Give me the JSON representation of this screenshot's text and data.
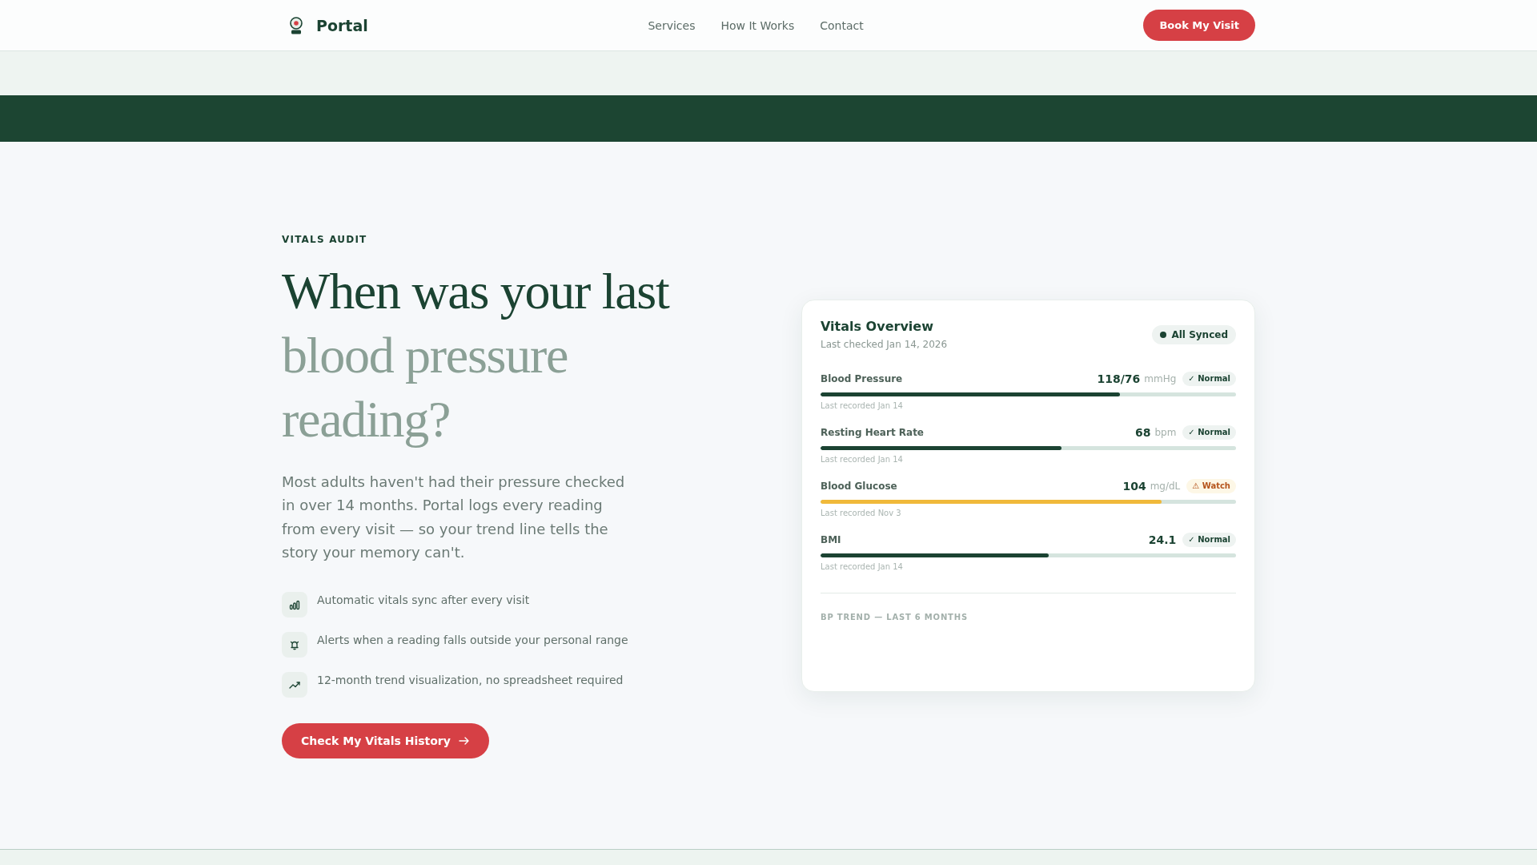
{
  "header": {
    "logo_text": "Portal",
    "nav": [
      {
        "label": "Services"
      },
      {
        "label": "How It Works"
      },
      {
        "label": "Contact"
      }
    ],
    "cta": "Book My Visit"
  },
  "hero": {
    "eyebrow": "VITALS AUDIT",
    "headline": [
      {
        "text": "When was your last",
        "kind": "strong"
      },
      {
        "text": "blood pressure reading?",
        "kind": "muted"
      }
    ],
    "body": "Most adults haven't had their pressure checked in over 14 months. Portal logs every reading from every visit — so your trend line tells the story your memory can't.",
    "features": [
      {
        "kind": "sync",
        "text": "Automatic vitals sync after every visit"
      },
      {
        "kind": "alert",
        "text": "Alerts when a reading falls outside your personal range"
      },
      {
        "kind": "trend",
        "text": "12-month trend visualization, no spreadsheet required"
      }
    ],
    "cta": "Check My Vitals History"
  },
  "vitals_card": {
    "title": "Vitals Overview",
    "subtitle": "Last checked Jan 14, 2026",
    "sync_badge": "All Synced",
    "metrics": [
      {
        "name": "Blood Pressure",
        "value": "118/76",
        "unit": "mmHg",
        "status": {
          "kind": "normal",
          "label": "✓ Normal"
        },
        "level": 0.72,
        "note": "Last recorded Jan 14"
      },
      {
        "name": "Resting Heart Rate",
        "value": "68",
        "unit": "bpm",
        "status": {
          "kind": "normal",
          "label": "✓ Normal"
        },
        "level": 0.58,
        "note": "Last recorded Jan 14"
      },
      {
        "name": "Blood Glucose",
        "value": "104",
        "unit": "mg/dL",
        "status": {
          "kind": "watch",
          "label": "⚠ Watch"
        },
        "level": 0.82,
        "note": "Last recorded Nov 3"
      },
      {
        "name": "BMI",
        "value": "24.1",
        "status": {
          "kind": "normal",
          "label": "✓ Normal"
        },
        "level": 0.55,
        "note": "Last recorded Jan 14"
      }
    ],
    "trend_title": "BP TREND — LAST 6 MONTHS"
  }
}
